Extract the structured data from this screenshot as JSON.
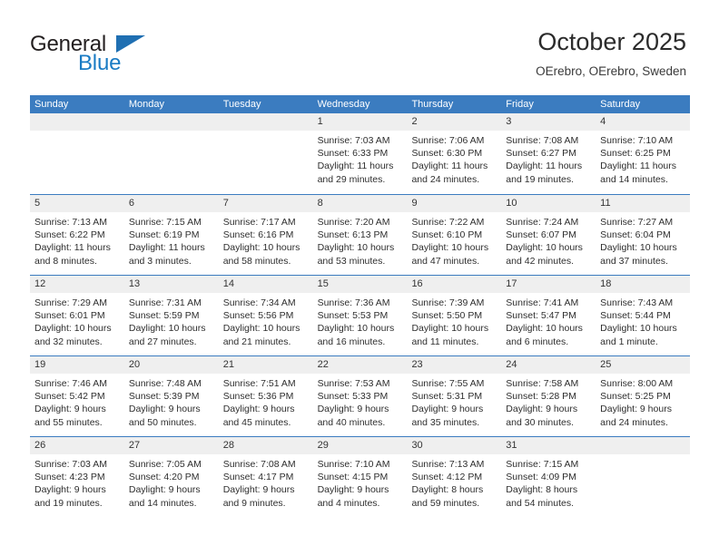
{
  "brand": {
    "name_part1": "General",
    "name_part2": "Blue",
    "logo_icon": "triangle-flag-icon"
  },
  "header": {
    "title": "October 2025",
    "subtitle": "OErebro, OErebro, Sweden"
  },
  "weekdays": [
    "Sunday",
    "Monday",
    "Tuesday",
    "Wednesday",
    "Thursday",
    "Friday",
    "Saturday"
  ],
  "colors": {
    "header_blue": "#3b7cc0",
    "brand_blue": "#1a7bc4",
    "day_band_gray": "#efefef",
    "text": "#2e2e2e"
  },
  "weeks": [
    [
      {
        "day": "",
        "sunrise": "",
        "sunset": "",
        "daylight_1": "",
        "daylight_2": ""
      },
      {
        "day": "",
        "sunrise": "",
        "sunset": "",
        "daylight_1": "",
        "daylight_2": ""
      },
      {
        "day": "",
        "sunrise": "",
        "sunset": "",
        "daylight_1": "",
        "daylight_2": ""
      },
      {
        "day": "1",
        "sunrise": "Sunrise: 7:03 AM",
        "sunset": "Sunset: 6:33 PM",
        "daylight_1": "Daylight: 11 hours",
        "daylight_2": "and 29 minutes."
      },
      {
        "day": "2",
        "sunrise": "Sunrise: 7:06 AM",
        "sunset": "Sunset: 6:30 PM",
        "daylight_1": "Daylight: 11 hours",
        "daylight_2": "and 24 minutes."
      },
      {
        "day": "3",
        "sunrise": "Sunrise: 7:08 AM",
        "sunset": "Sunset: 6:27 PM",
        "daylight_1": "Daylight: 11 hours",
        "daylight_2": "and 19 minutes."
      },
      {
        "day": "4",
        "sunrise": "Sunrise: 7:10 AM",
        "sunset": "Sunset: 6:25 PM",
        "daylight_1": "Daylight: 11 hours",
        "daylight_2": "and 14 minutes."
      }
    ],
    [
      {
        "day": "5",
        "sunrise": "Sunrise: 7:13 AM",
        "sunset": "Sunset: 6:22 PM",
        "daylight_1": "Daylight: 11 hours",
        "daylight_2": "and 8 minutes."
      },
      {
        "day": "6",
        "sunrise": "Sunrise: 7:15 AM",
        "sunset": "Sunset: 6:19 PM",
        "daylight_1": "Daylight: 11 hours",
        "daylight_2": "and 3 minutes."
      },
      {
        "day": "7",
        "sunrise": "Sunrise: 7:17 AM",
        "sunset": "Sunset: 6:16 PM",
        "daylight_1": "Daylight: 10 hours",
        "daylight_2": "and 58 minutes."
      },
      {
        "day": "8",
        "sunrise": "Sunrise: 7:20 AM",
        "sunset": "Sunset: 6:13 PM",
        "daylight_1": "Daylight: 10 hours",
        "daylight_2": "and 53 minutes."
      },
      {
        "day": "9",
        "sunrise": "Sunrise: 7:22 AM",
        "sunset": "Sunset: 6:10 PM",
        "daylight_1": "Daylight: 10 hours",
        "daylight_2": "and 47 minutes."
      },
      {
        "day": "10",
        "sunrise": "Sunrise: 7:24 AM",
        "sunset": "Sunset: 6:07 PM",
        "daylight_1": "Daylight: 10 hours",
        "daylight_2": "and 42 minutes."
      },
      {
        "day": "11",
        "sunrise": "Sunrise: 7:27 AM",
        "sunset": "Sunset: 6:04 PM",
        "daylight_1": "Daylight: 10 hours",
        "daylight_2": "and 37 minutes."
      }
    ],
    [
      {
        "day": "12",
        "sunrise": "Sunrise: 7:29 AM",
        "sunset": "Sunset: 6:01 PM",
        "daylight_1": "Daylight: 10 hours",
        "daylight_2": "and 32 minutes."
      },
      {
        "day": "13",
        "sunrise": "Sunrise: 7:31 AM",
        "sunset": "Sunset: 5:59 PM",
        "daylight_1": "Daylight: 10 hours",
        "daylight_2": "and 27 minutes."
      },
      {
        "day": "14",
        "sunrise": "Sunrise: 7:34 AM",
        "sunset": "Sunset: 5:56 PM",
        "daylight_1": "Daylight: 10 hours",
        "daylight_2": "and 21 minutes."
      },
      {
        "day": "15",
        "sunrise": "Sunrise: 7:36 AM",
        "sunset": "Sunset: 5:53 PM",
        "daylight_1": "Daylight: 10 hours",
        "daylight_2": "and 16 minutes."
      },
      {
        "day": "16",
        "sunrise": "Sunrise: 7:39 AM",
        "sunset": "Sunset: 5:50 PM",
        "daylight_1": "Daylight: 10 hours",
        "daylight_2": "and 11 minutes."
      },
      {
        "day": "17",
        "sunrise": "Sunrise: 7:41 AM",
        "sunset": "Sunset: 5:47 PM",
        "daylight_1": "Daylight: 10 hours",
        "daylight_2": "and 6 minutes."
      },
      {
        "day": "18",
        "sunrise": "Sunrise: 7:43 AM",
        "sunset": "Sunset: 5:44 PM",
        "daylight_1": "Daylight: 10 hours",
        "daylight_2": "and 1 minute."
      }
    ],
    [
      {
        "day": "19",
        "sunrise": "Sunrise: 7:46 AM",
        "sunset": "Sunset: 5:42 PM",
        "daylight_1": "Daylight: 9 hours",
        "daylight_2": "and 55 minutes."
      },
      {
        "day": "20",
        "sunrise": "Sunrise: 7:48 AM",
        "sunset": "Sunset: 5:39 PM",
        "daylight_1": "Daylight: 9 hours",
        "daylight_2": "and 50 minutes."
      },
      {
        "day": "21",
        "sunrise": "Sunrise: 7:51 AM",
        "sunset": "Sunset: 5:36 PM",
        "daylight_1": "Daylight: 9 hours",
        "daylight_2": "and 45 minutes."
      },
      {
        "day": "22",
        "sunrise": "Sunrise: 7:53 AM",
        "sunset": "Sunset: 5:33 PM",
        "daylight_1": "Daylight: 9 hours",
        "daylight_2": "and 40 minutes."
      },
      {
        "day": "23",
        "sunrise": "Sunrise: 7:55 AM",
        "sunset": "Sunset: 5:31 PM",
        "daylight_1": "Daylight: 9 hours",
        "daylight_2": "and 35 minutes."
      },
      {
        "day": "24",
        "sunrise": "Sunrise: 7:58 AM",
        "sunset": "Sunset: 5:28 PM",
        "daylight_1": "Daylight: 9 hours",
        "daylight_2": "and 30 minutes."
      },
      {
        "day": "25",
        "sunrise": "Sunrise: 8:00 AM",
        "sunset": "Sunset: 5:25 PM",
        "daylight_1": "Daylight: 9 hours",
        "daylight_2": "and 24 minutes."
      }
    ],
    [
      {
        "day": "26",
        "sunrise": "Sunrise: 7:03 AM",
        "sunset": "Sunset: 4:23 PM",
        "daylight_1": "Daylight: 9 hours",
        "daylight_2": "and 19 minutes."
      },
      {
        "day": "27",
        "sunrise": "Sunrise: 7:05 AM",
        "sunset": "Sunset: 4:20 PM",
        "daylight_1": "Daylight: 9 hours",
        "daylight_2": "and 14 minutes."
      },
      {
        "day": "28",
        "sunrise": "Sunrise: 7:08 AM",
        "sunset": "Sunset: 4:17 PM",
        "daylight_1": "Daylight: 9 hours",
        "daylight_2": "and 9 minutes."
      },
      {
        "day": "29",
        "sunrise": "Sunrise: 7:10 AM",
        "sunset": "Sunset: 4:15 PM",
        "daylight_1": "Daylight: 9 hours",
        "daylight_2": "and 4 minutes."
      },
      {
        "day": "30",
        "sunrise": "Sunrise: 7:13 AM",
        "sunset": "Sunset: 4:12 PM",
        "daylight_1": "Daylight: 8 hours",
        "daylight_2": "and 59 minutes."
      },
      {
        "day": "31",
        "sunrise": "Sunrise: 7:15 AM",
        "sunset": "Sunset: 4:09 PM",
        "daylight_1": "Daylight: 8 hours",
        "daylight_2": "and 54 minutes."
      },
      {
        "day": "",
        "sunrise": "",
        "sunset": "",
        "daylight_1": "",
        "daylight_2": ""
      }
    ]
  ]
}
